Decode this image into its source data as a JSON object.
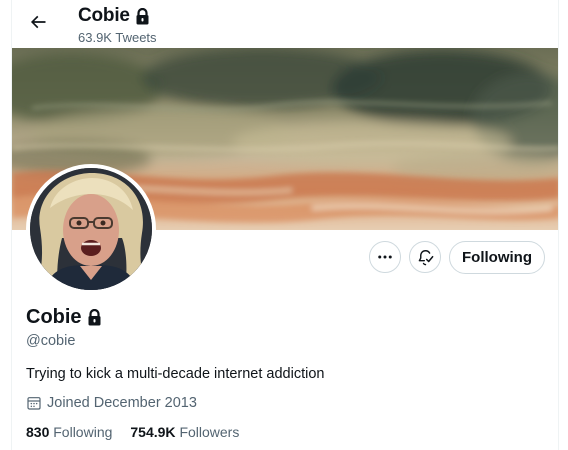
{
  "header": {
    "name": "Cobie",
    "tweet_count": "63.9K Tweets"
  },
  "profile": {
    "display_name": "Cobie",
    "handle": "@cobie",
    "bio": "Trying to kick a multi-decade internet addiction",
    "joined": "Joined December 2013",
    "following_count": "830",
    "following_label": "Following",
    "followers_count": "754.9K",
    "followers_label": "Followers",
    "protected": true
  },
  "actions": {
    "more_icon": "more-horizontal-icon",
    "notify_icon": "bell-check-icon",
    "following_button": "Following"
  },
  "colors": {
    "text_primary": "#0f1419",
    "text_secondary": "#536471",
    "border": "#cfd9de"
  }
}
